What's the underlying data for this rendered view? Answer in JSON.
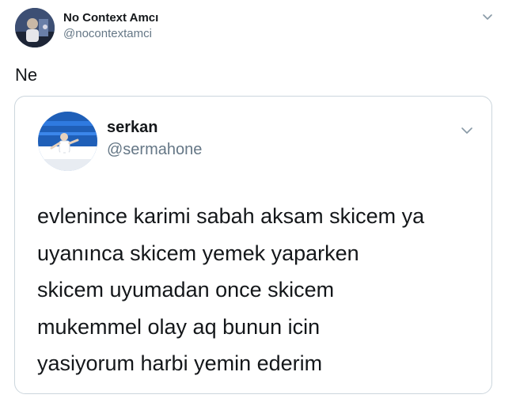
{
  "tweet": {
    "author_name": "No Context Amcı",
    "author_handle": "@nocontextamci",
    "text": "Ne",
    "avatar_icon": "user-avatar",
    "menu_icon": "chevron-down-icon"
  },
  "quoted_tweet": {
    "author_name": "serkan",
    "author_handle": "@sermahone",
    "avatar_icon": "user-avatar",
    "menu_icon": "chevron-down-icon",
    "text_lines": [
      "evlenince karimi sabah aksam skicem ya",
      "uyanınca skicem yemek yaparken",
      "skicem uyumadan once skicem",
      "mukemmel olay aq bunun icin",
      "yasiyorum harbi yemin ederim"
    ]
  },
  "colors": {
    "text_primary": "#14171a",
    "text_secondary": "#657786",
    "border": "#ccd6dd"
  }
}
